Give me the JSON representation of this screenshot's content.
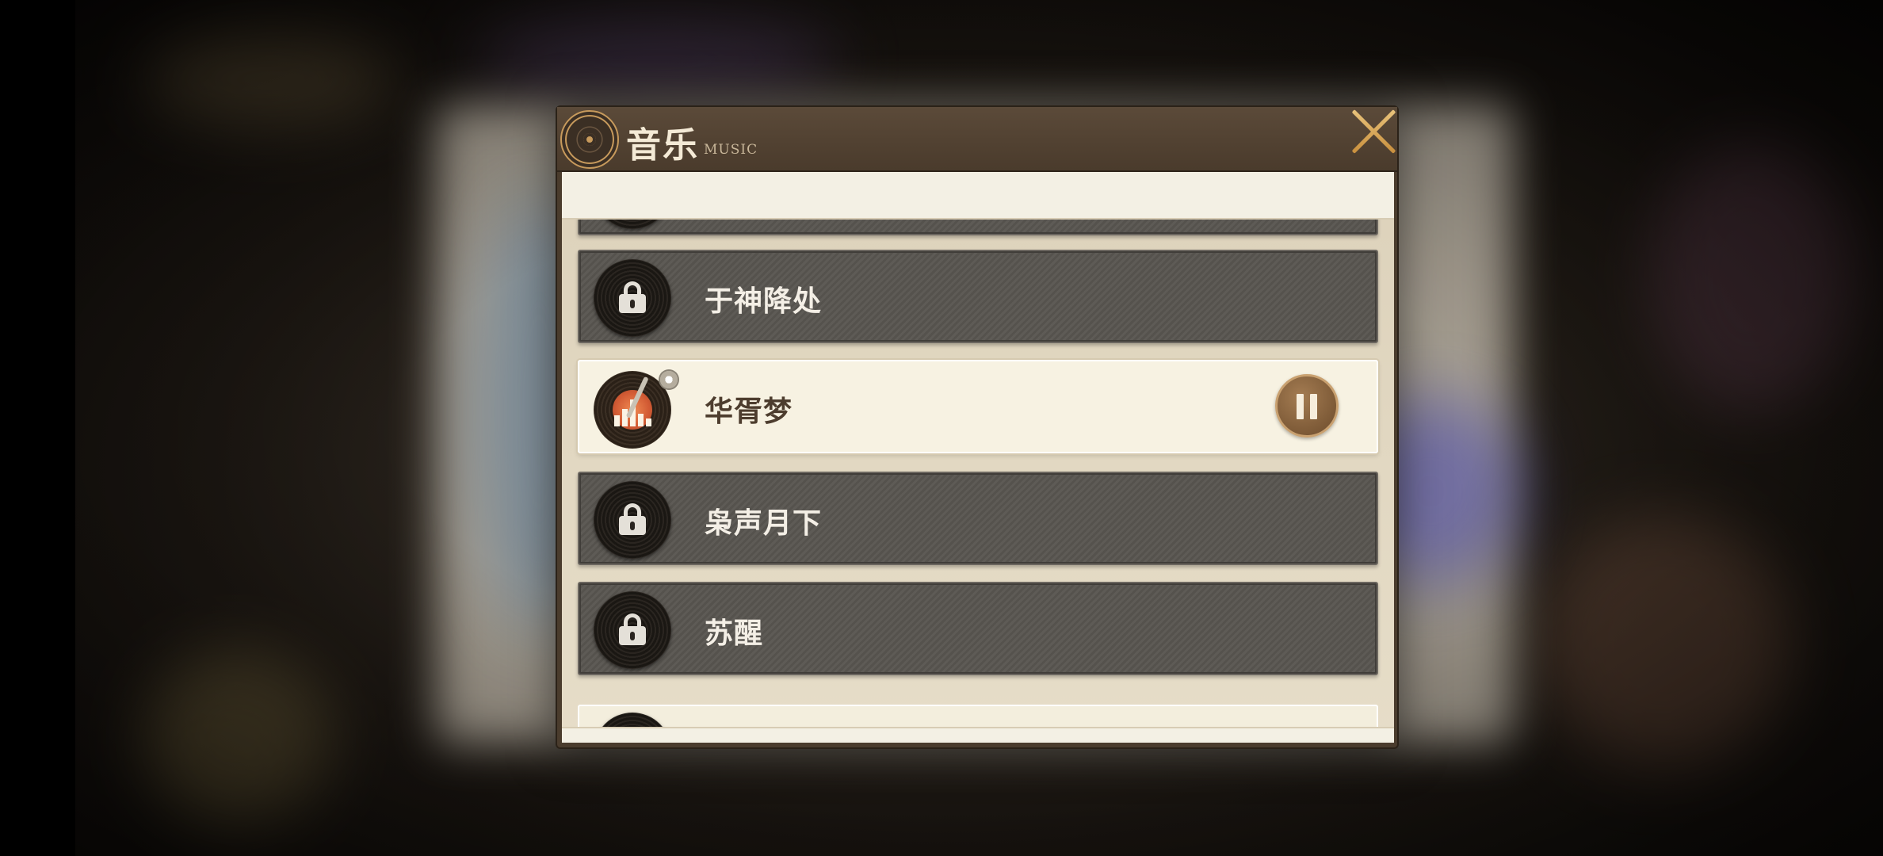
{
  "header": {
    "title": "音乐",
    "subtitle": "MUSIC"
  },
  "icons": {
    "logo": "vinyl-gear-icon",
    "close": "close-icon",
    "locked": "lock-icon",
    "playing": "turntable-icon",
    "pause": "pause-icon"
  },
  "songs": [
    {
      "title": "",
      "state": "locked-partial"
    },
    {
      "title": "于神降处",
      "state": "locked"
    },
    {
      "title": "华胥梦",
      "state": "playing"
    },
    {
      "title": "枭声月下",
      "state": "locked"
    },
    {
      "title": "苏醒",
      "state": "locked"
    },
    {
      "title": "",
      "state": "unlocked-partial"
    }
  ],
  "colors": {
    "accent": "#c9a170",
    "header_bg": "#4a3b2c",
    "locked_row": "#5e5b56",
    "active_row": "#f7f2e2",
    "playing_label": "#d25b34"
  }
}
